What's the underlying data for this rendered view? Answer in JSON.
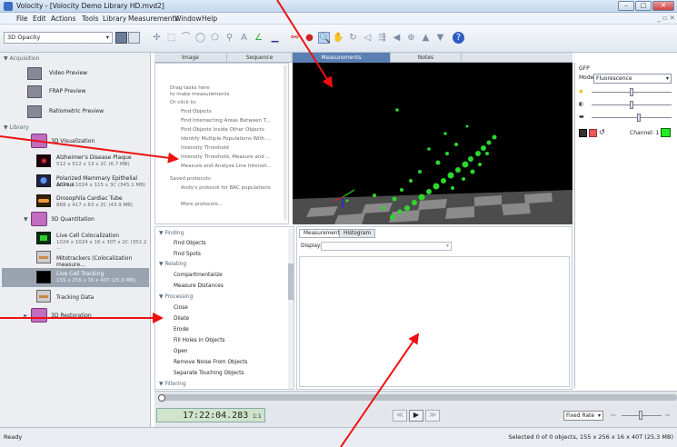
{
  "window": {
    "title": "Volocity - [Volocity Demo Library HD.mvd2]"
  },
  "menu": [
    "File",
    "Edit",
    "Actions",
    "Tools",
    "Library",
    "Measurements",
    "Window",
    "Help"
  ],
  "toolbar": {
    "view_mode": "3D Opacity"
  },
  "sidebar": {
    "sections": {
      "acquisition": "Acquisition",
      "library": "Library"
    },
    "acquisition_items": [
      "Video Preview",
      "FRAP Preview",
      "Ratiometric Preview"
    ],
    "library_items": [
      {
        "label": "3D Visualization",
        "type": "folder"
      },
      {
        "label": "Alzheimer's Disease Plaque",
        "sub": "512 x 512 x 13 x 2C (6.7 MB)"
      },
      {
        "label": "Polarized Mammary Epithelial Acinus",
        "sub": "1024 x 1024 x 115 x 3C (345.1 MB)"
      },
      {
        "label": "Drosophila Cardiac Tube",
        "sub": "868 x 417 x 63 x 2C (43.9 MB)"
      },
      {
        "label": "3D Quantitation",
        "type": "folder"
      },
      {
        "label": "Live Cell Colocalization",
        "sub": "1024 x 1024 x 16 x 30T x 2C (352.2 ..."
      },
      {
        "label": "Mitotrackers (Colocalization measure...",
        "sub": ""
      },
      {
        "label": "Live Cell Tracking",
        "sub": "155 x 256 x 16 x 40T (25.3 MB)"
      },
      {
        "label": "Tracking Data",
        "sub": ""
      },
      {
        "label": "3D Restoration",
        "type": "folder"
      }
    ]
  },
  "tabs": [
    "Image",
    "Sequence",
    "Measurements",
    "Notes"
  ],
  "tasks_panel": {
    "hint1": "Drag tasks here",
    "hint2": "to make measurements",
    "or": "Or click to:",
    "links": [
      "Find Objects",
      "Find Intersecting Areas Between T...",
      "Find Objects Inside Other Objects",
      "Identify Multiple Populations With ...",
      "Intensity Threshold",
      "Intensity Threshold, Measure and ...",
      "Measure and Analyze Line Intensit..."
    ],
    "saved": "Saved protocols:",
    "saved_item": "Andy's protocol for BAC populations",
    "more": "More protocols..."
  },
  "gfp_panel": {
    "title": "GFP",
    "mode_label": "Mode:",
    "mode_value": "Fluorescence",
    "channel_label": "Channel: 1",
    "channel_color": "#22ee22"
  },
  "task_tree": [
    {
      "group": "Finding",
      "items": [
        "Find Objects",
        "Find Spots"
      ]
    },
    {
      "group": "Relating",
      "items": [
        "Compartmentalize",
        "Measure Distances"
      ]
    },
    {
      "group": "Processing",
      "items": [
        "Close",
        "Dilate",
        "Erode",
        "Fill Holes in Objects",
        "Open",
        "Remove Noise From Objects",
        "Separate Touching Objects"
      ]
    },
    {
      "group": "Filtering",
      "items": []
    }
  ],
  "measurements": {
    "tabs": [
      "Measurements",
      "Histogram"
    ],
    "display_label": "Display:"
  },
  "playback": {
    "timecode": "17:22:04.283",
    "speed": "1:1",
    "rate": "Fixed Rate"
  },
  "status": {
    "left": "Ready",
    "right": "Selected 0 of 0 objects, 155 x 256 x 16 x 40T (25.3 MB)"
  }
}
